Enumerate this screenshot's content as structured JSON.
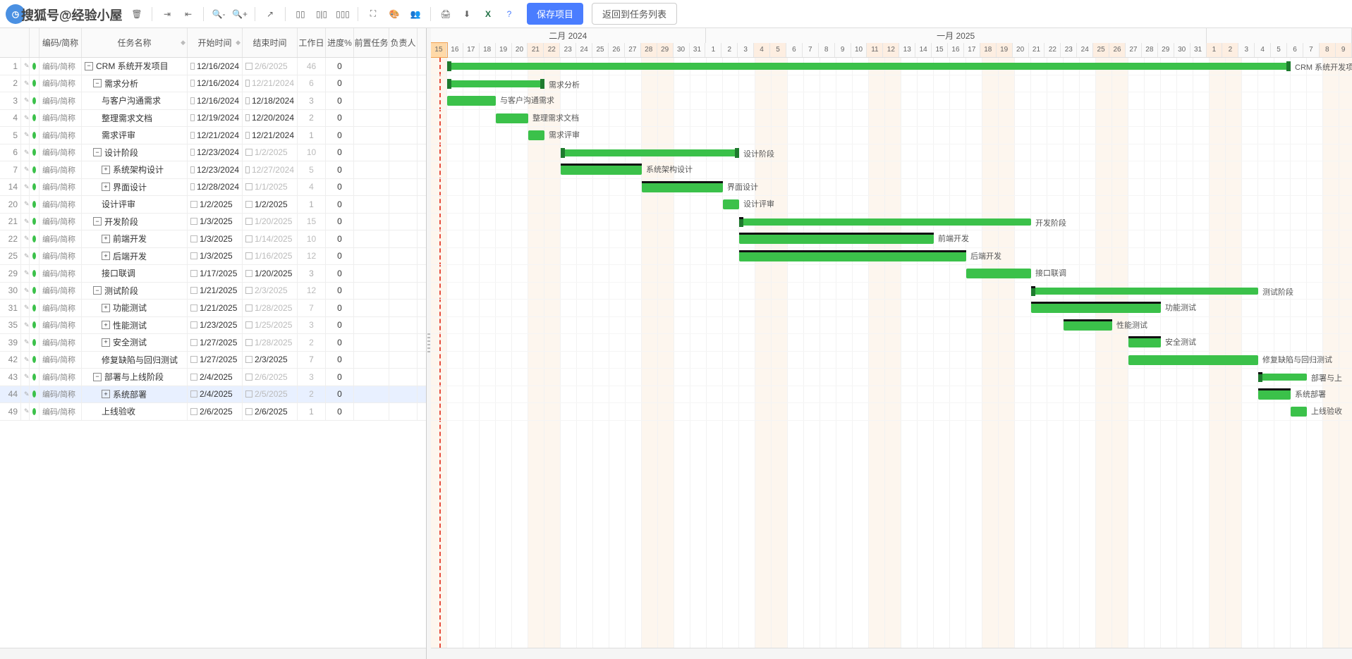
{
  "watermark": "搜狐号@经验小屋",
  "toolbar": {
    "save": "保存项目",
    "back": "返回到任务列表"
  },
  "columns": {
    "code": "编码/简称",
    "name": "任务名称",
    "start": "开始时间",
    "end": "结束时间",
    "work": "工作日",
    "progress": "进度%",
    "pred": "前置任务",
    "owner": "负责人"
  },
  "timeline": {
    "months": [
      {
        "label": "二月 2024",
        "offset": 0,
        "days": 17
      },
      {
        "label": "一月 2025",
        "offset": 17,
        "days": 31
      },
      {
        "label": "",
        "offset": 48,
        "days": 9
      }
    ],
    "startYear": 2024,
    "startMonth": 12,
    "startDay": 15,
    "totalDays": 57,
    "todayIndex": 0,
    "weekendIdx": [
      0,
      6,
      7,
      13,
      14,
      20,
      21,
      27,
      28,
      34,
      35,
      41,
      42,
      48,
      49,
      55,
      56
    ],
    "highlightIdx": [
      0,
      7,
      14,
      21,
      28,
      35,
      42,
      49,
      56
    ]
  },
  "tasks": [
    {
      "num": 1,
      "code": "编码/简称",
      "name": "CRM 系统开发项目",
      "level": 0,
      "toggle": "-",
      "start": "12/16/2024",
      "end": "2/6/2025",
      "endDim": true,
      "work": "46",
      "workDim": true,
      "prog": "0",
      "barStart": 1,
      "barLen": 52,
      "summary": true,
      "critical": false
    },
    {
      "num": 2,
      "code": "编码/简称",
      "name": "需求分析",
      "level": 1,
      "toggle": "-",
      "start": "12/16/2024",
      "end": "12/21/2024",
      "endDim": true,
      "work": "6",
      "workDim": true,
      "prog": "0",
      "barStart": 1,
      "barLen": 6,
      "summary": true
    },
    {
      "num": 3,
      "code": "编码/简称",
      "name": "与客户沟通需求",
      "level": 2,
      "start": "12/16/2024",
      "end": "12/18/2024",
      "work": "3",
      "prog": "0",
      "barStart": 1,
      "barLen": 3
    },
    {
      "num": 4,
      "code": "编码/简称",
      "name": "整理需求文档",
      "level": 2,
      "start": "12/19/2024",
      "end": "12/20/2024",
      "work": "2",
      "prog": "0",
      "barStart": 4,
      "barLen": 2
    },
    {
      "num": 5,
      "code": "编码/简称",
      "name": "需求评审",
      "level": 2,
      "start": "12/21/2024",
      "end": "12/21/2024",
      "work": "1",
      "prog": "0",
      "barStart": 6,
      "barLen": 1
    },
    {
      "num": 6,
      "code": "编码/简称",
      "name": "设计阶段",
      "level": 1,
      "toggle": "-",
      "start": "12/23/2024",
      "end": "1/2/2025",
      "endDim": true,
      "work": "10",
      "workDim": true,
      "prog": "0",
      "barStart": 8,
      "barLen": 11,
      "summary": true
    },
    {
      "num": 7,
      "code": "编码/简称",
      "name": "系统架构设计",
      "level": 2,
      "toggle": "+",
      "start": "12/23/2024",
      "end": "12/27/2024",
      "endDim": true,
      "work": "5",
      "workDim": true,
      "prog": "0",
      "barStart": 8,
      "barLen": 5,
      "critical": true
    },
    {
      "num": 14,
      "code": "编码/简称",
      "name": "界面设计",
      "level": 2,
      "toggle": "+",
      "start": "12/28/2024",
      "end": "1/1/2025",
      "endDim": true,
      "work": "4",
      "workDim": true,
      "prog": "0",
      "barStart": 13,
      "barLen": 5,
      "critical": true
    },
    {
      "num": 20,
      "code": "编码/简称",
      "name": "设计评审",
      "level": 2,
      "start": "1/2/2025",
      "end": "1/2/2025",
      "work": "1",
      "prog": "0",
      "barStart": 18,
      "barLen": 1
    },
    {
      "num": 21,
      "code": "编码/简称",
      "name": "开发阶段",
      "level": 1,
      "toggle": "-",
      "start": "1/3/2025",
      "end": "1/20/2025",
      "endDim": true,
      "work": "15",
      "workDim": true,
      "prog": "0",
      "barStart": 19,
      "barLen": 18,
      "summary": true,
      "critical": true
    },
    {
      "num": 22,
      "code": "编码/简称",
      "name": "前端开发",
      "level": 2,
      "toggle": "+",
      "start": "1/3/2025",
      "end": "1/14/2025",
      "endDim": true,
      "work": "10",
      "workDim": true,
      "prog": "0",
      "barStart": 19,
      "barLen": 12,
      "critical": true
    },
    {
      "num": 25,
      "code": "编码/简称",
      "name": "后端开发",
      "level": 2,
      "toggle": "+",
      "start": "1/3/2025",
      "end": "1/16/2025",
      "endDim": true,
      "work": "12",
      "workDim": true,
      "prog": "0",
      "barStart": 19,
      "barLen": 14,
      "critical": true
    },
    {
      "num": 29,
      "code": "编码/简称",
      "name": "接口联调",
      "level": 2,
      "start": "1/17/2025",
      "end": "1/20/2025",
      "work": "3",
      "prog": "0",
      "barStart": 33,
      "barLen": 4
    },
    {
      "num": 30,
      "code": "编码/简称",
      "name": "测试阶段",
      "level": 1,
      "toggle": "-",
      "start": "1/21/2025",
      "end": "2/3/2025",
      "endDim": true,
      "work": "12",
      "workDim": true,
      "prog": "0",
      "barStart": 37,
      "barLen": 14,
      "summary": true,
      "critical": true
    },
    {
      "num": 31,
      "code": "编码/简称",
      "name": "功能测试",
      "level": 2,
      "toggle": "+",
      "start": "1/21/2025",
      "end": "1/28/2025",
      "endDim": true,
      "work": "7",
      "workDim": true,
      "prog": "0",
      "barStart": 37,
      "barLen": 8,
      "critical": true
    },
    {
      "num": 35,
      "code": "编码/简称",
      "name": "性能测试",
      "level": 2,
      "toggle": "+",
      "start": "1/23/2025",
      "end": "1/25/2025",
      "endDim": true,
      "work": "3",
      "workDim": true,
      "prog": "0",
      "barStart": 39,
      "barLen": 3,
      "critical": true
    },
    {
      "num": 39,
      "code": "编码/简称",
      "name": "安全测试",
      "level": 2,
      "toggle": "+",
      "start": "1/27/2025",
      "end": "1/28/2025",
      "endDim": true,
      "work": "2",
      "workDim": true,
      "prog": "0",
      "barStart": 43,
      "barLen": 2,
      "critical": true
    },
    {
      "num": 42,
      "code": "编码/简称",
      "name": "修复缺陷与回归测试",
      "level": 2,
      "start": "1/27/2025",
      "end": "2/3/2025",
      "work": "7",
      "prog": "0",
      "barStart": 43,
      "barLen": 8
    },
    {
      "num": 43,
      "code": "编码/简称",
      "name": "部署与上线阶段",
      "level": 1,
      "toggle": "-",
      "start": "2/4/2025",
      "end": "2/6/2025",
      "endDim": true,
      "work": "3",
      "workDim": true,
      "prog": "0",
      "barStart": 51,
      "barLen": 3,
      "summary": true,
      "critical": true,
      "shortLabel": "部署与上"
    },
    {
      "num": 44,
      "code": "编码/简称",
      "name": "系统部署",
      "level": 2,
      "toggle": "+",
      "start": "2/4/2025",
      "end": "2/5/2025",
      "endDim": true,
      "work": "2",
      "workDim": true,
      "prog": "0",
      "barStart": 51,
      "barLen": 2,
      "critical": true,
      "selected": true
    },
    {
      "num": 49,
      "code": "编码/简称",
      "name": "上线验收",
      "level": 2,
      "start": "2/6/2025",
      "end": "2/6/2025",
      "work": "1",
      "prog": "0",
      "barStart": 53,
      "barLen": 1
    }
  ]
}
